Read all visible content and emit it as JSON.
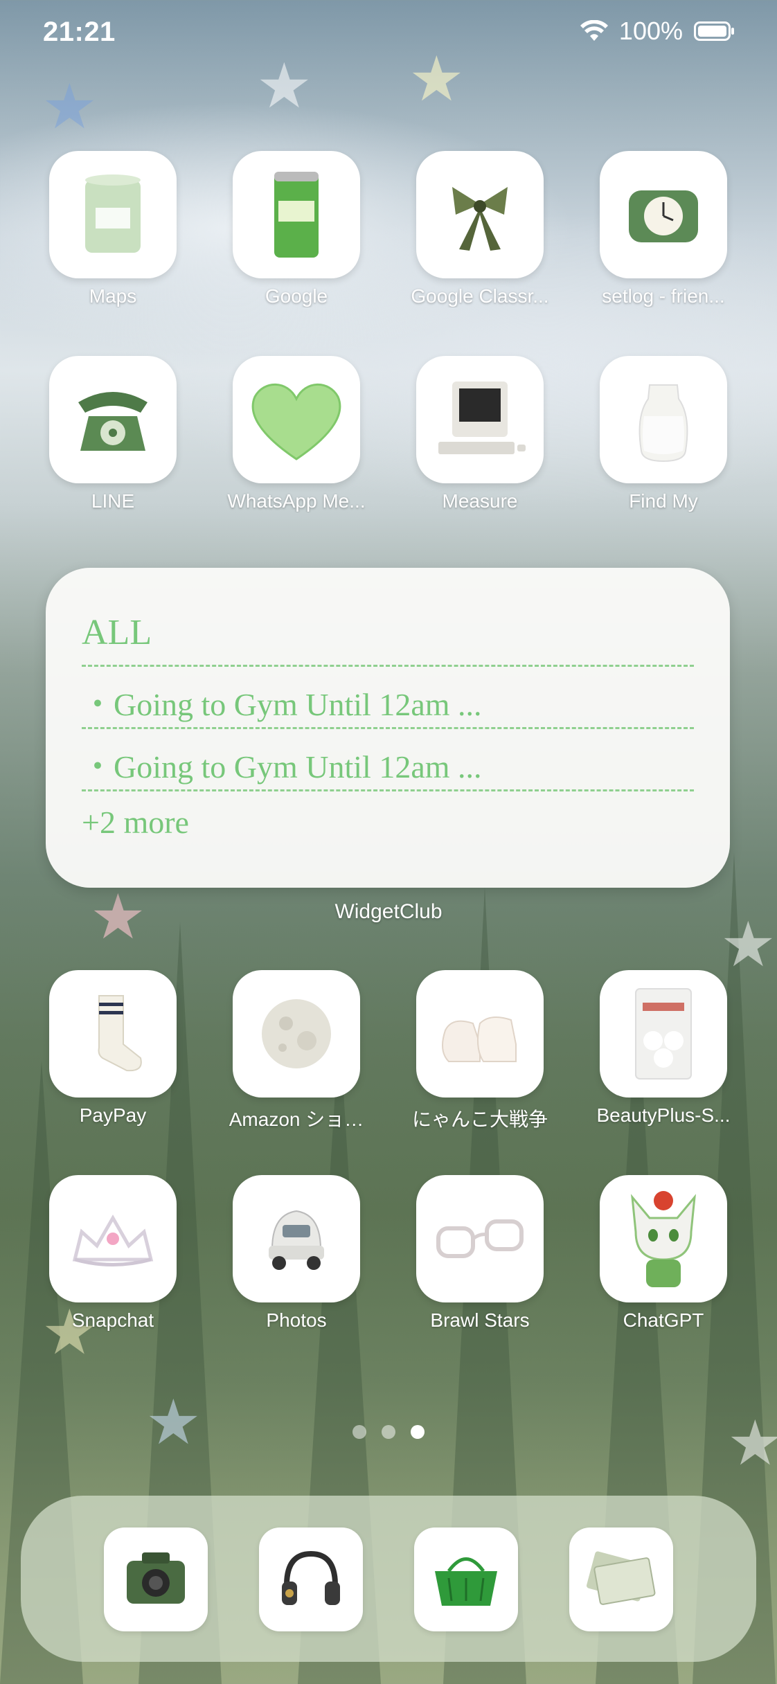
{
  "status_bar": {
    "time": "21:21",
    "battery": "100%"
  },
  "apps_row1": [
    {
      "label": "Maps",
      "icon": "candle-icon"
    },
    {
      "label": "Google",
      "icon": "green-tea-can-icon"
    },
    {
      "label": "Google Classr...",
      "icon": "ribbon-bow-icon"
    },
    {
      "label": "setlog - frien...",
      "icon": "alarm-clock-icon"
    }
  ],
  "apps_row2": [
    {
      "label": "LINE",
      "icon": "telephone-icon"
    },
    {
      "label": "WhatsApp Me...",
      "icon": "heart-icon"
    },
    {
      "label": "Measure",
      "icon": "computer-icon"
    },
    {
      "label": "Find My",
      "icon": "milk-jug-icon"
    }
  ],
  "widget": {
    "title": "ALL",
    "items": [
      "・Going to Gym Until 12am ...",
      "・Going to Gym Until 12am ..."
    ],
    "more": "+2 more",
    "caption": "WidgetClub"
  },
  "apps_row3": [
    {
      "label": "PayPay",
      "icon": "socks-icon"
    },
    {
      "label": "Amazon ショ…",
      "icon": "moon-icon"
    },
    {
      "label": "にゃんこ大戦争",
      "icon": "shoes-icon"
    },
    {
      "label": "BeautyPlus-S...",
      "icon": "cotton-pads-icon"
    }
  ],
  "apps_row4": [
    {
      "label": "Snapchat",
      "icon": "tiara-icon"
    },
    {
      "label": "Photos",
      "icon": "car-icon"
    },
    {
      "label": "Brawl Stars",
      "icon": "glasses-icon"
    },
    {
      "label": "ChatGPT",
      "icon": "cat-character-icon"
    }
  ],
  "page_dots": {
    "count": 3,
    "active": 3
  },
  "dock": [
    {
      "icon": "camera-icon"
    },
    {
      "icon": "headphones-icon"
    },
    {
      "icon": "shopping-basket-icon"
    },
    {
      "icon": "money-icon"
    }
  ],
  "colors": {
    "widget_text": "#77c77a",
    "widget_bg": "#fafaf8"
  }
}
